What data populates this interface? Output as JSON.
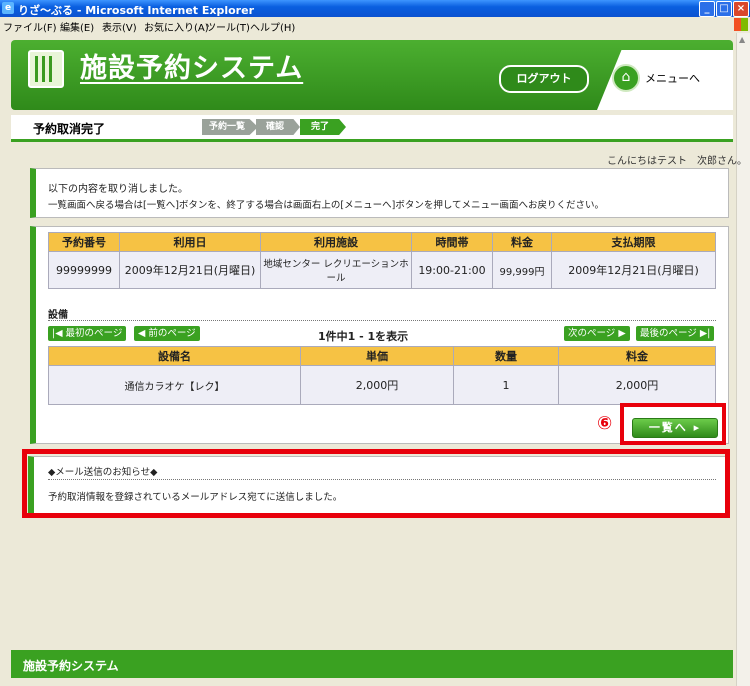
{
  "window": {
    "title": "りざ～ぶる - Microsoft Internet Explorer",
    "buttons": [
      "_",
      "□",
      "×"
    ]
  },
  "menubar": [
    "ファイル(F)",
    "編集(E)",
    "表示(V)",
    "お気に入り(A)",
    "ツール(T)",
    "ヘルプ(H)"
  ],
  "header": {
    "app_title": "施設予約システム",
    "logout_label": "ログアウト",
    "menu_label": "メニューへ"
  },
  "subheader": {
    "page_title": "予約取消完了",
    "steps": [
      "予約一覧",
      "確認",
      "完了"
    ]
  },
  "greeting": "こんにちはテスト　次郎さん。",
  "notice": {
    "line1": "以下の内容を取り消しました。",
    "line2": "一覧画面へ戻る場合は[一覧へ]ボタンを、終了する場合は画面右上の[メニューへ]ボタンを押してメニュー画面へお戻りください。"
  },
  "reservation": {
    "headers": [
      "予約番号",
      "利用日",
      "利用施設",
      "時間帯",
      "料金",
      "支払期限"
    ],
    "row": [
      "99999999",
      "2009年12月21日(月曜日)",
      "地域センター レクリエーションホール",
      "19:00-21:00",
      "99,999円",
      "2009年12月21日(月曜日)"
    ]
  },
  "equipment": {
    "section_label": "設備",
    "first_page": "最初のページ",
    "prev_page": "前のページ",
    "pager_text": "1件中1 - 1を表示",
    "next_page": "次のページ",
    "last_page": "最後のページ",
    "headers": [
      "設備名",
      "単価",
      "数量",
      "料金"
    ],
    "row": [
      "通信カラオケ【レク】",
      "2,000円",
      "1",
      "2,000円"
    ]
  },
  "annotation": {
    "marker": "⑥",
    "list_button": "一覧へ"
  },
  "mail": {
    "title": "◆メール送信のお知らせ◆",
    "body": "予約取消情報を登録されているメールアドレス宛てに送信しました。"
  },
  "footer": "施設予約システム",
  "colors": {
    "accent_green": "#3aa121",
    "header_green": "#2f8a1a",
    "table_header": "#f6c244",
    "highlight_red": "#e8000b"
  }
}
